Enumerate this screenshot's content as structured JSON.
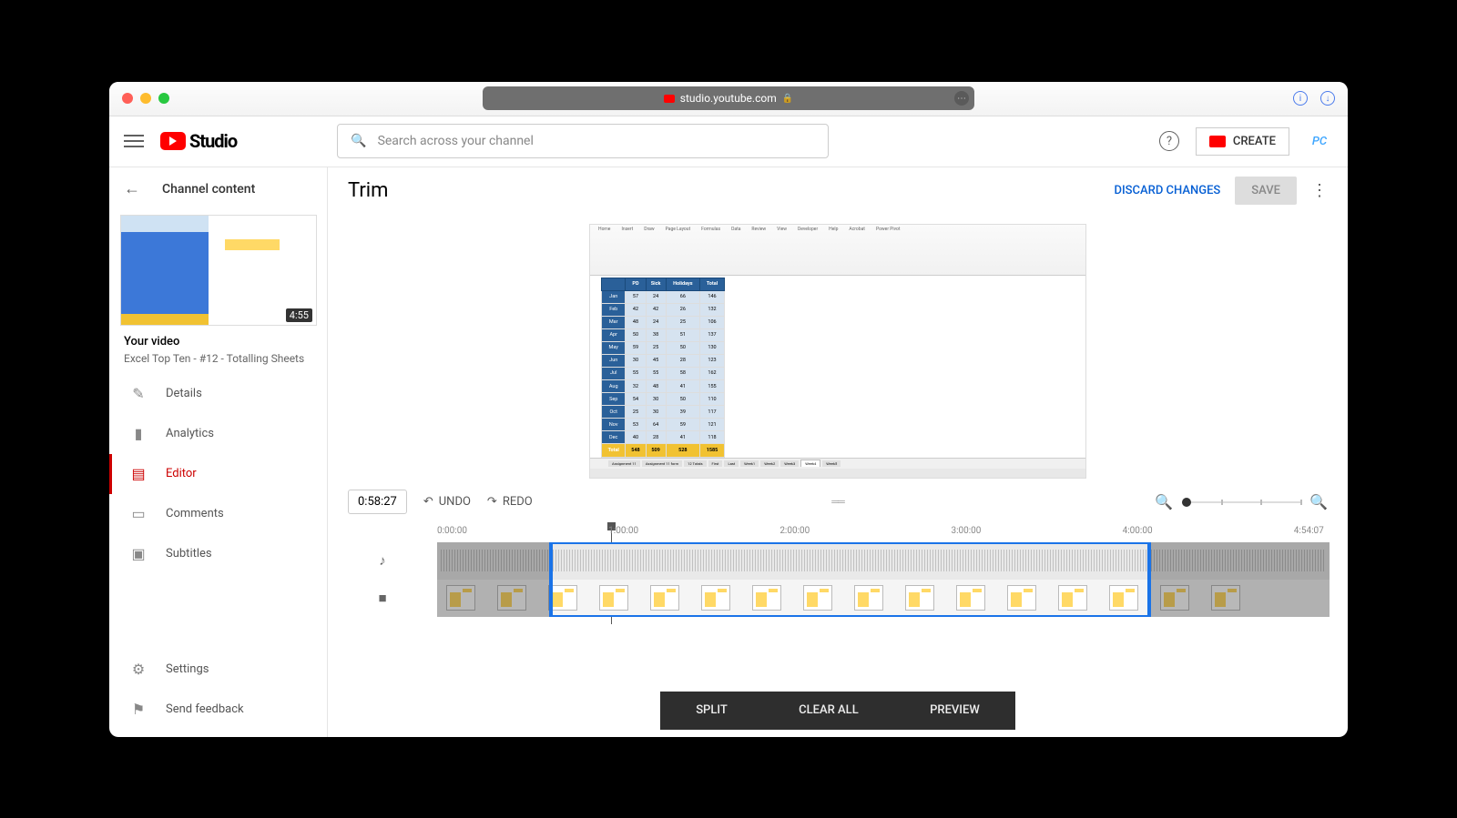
{
  "browser": {
    "url": "studio.youtube.com"
  },
  "header": {
    "logo_text": "Studio",
    "search_placeholder": "Search across your channel",
    "create_label": "CREATE",
    "avatar_text": "PC"
  },
  "sidebar": {
    "back_label": "Channel content",
    "thumb_duration": "4:55",
    "your_video_h": "Your video",
    "your_video_t": "Excel Top Ten - #12 - Totalling Sheets",
    "items": [
      {
        "label": "Details",
        "icon": "✎"
      },
      {
        "label": "Analytics",
        "icon": "▮"
      },
      {
        "label": "Editor",
        "icon": "▤"
      },
      {
        "label": "Comments",
        "icon": "▭"
      },
      {
        "label": "Subtitles",
        "icon": "▣"
      }
    ],
    "bottom": [
      {
        "label": "Settings",
        "icon": "⚙"
      },
      {
        "label": "Send feedback",
        "icon": "⚑"
      }
    ]
  },
  "main": {
    "title": "Trim",
    "discard": "DISCARD CHANGES",
    "save": "SAVE",
    "timecode": "0:58:27",
    "undo": "UNDO",
    "redo": "REDO",
    "ruler": [
      "0:00:00",
      "1:00:00",
      "2:00:00",
      "3:00:00",
      "4:00:00",
      "4:54:07"
    ],
    "bottom": {
      "split": "SPLIT",
      "clear": "CLEAR ALL",
      "preview": "PREVIEW"
    }
  },
  "preview_sheet": {
    "header": [
      "",
      "PD",
      "Sick",
      "Holidays",
      "Total"
    ],
    "rows": [
      [
        "Jan",
        "57",
        "24",
        "66",
        "146"
      ],
      [
        "Feb",
        "42",
        "42",
        "26",
        "132"
      ],
      [
        "Mar",
        "48",
        "24",
        "25",
        "106"
      ],
      [
        "Apr",
        "50",
        "38",
        "51",
        "137"
      ],
      [
        "May",
        "59",
        "25",
        "50",
        "130"
      ],
      [
        "Jun",
        "30",
        "45",
        "28",
        "123"
      ],
      [
        "Jul",
        "55",
        "55",
        "58",
        "162"
      ],
      [
        "Aug",
        "32",
        "48",
        "41",
        "155"
      ],
      [
        "Sep",
        "54",
        "30",
        "50",
        "110"
      ],
      [
        "Oct",
        "25",
        "30",
        "39",
        "117"
      ],
      [
        "Nov",
        "53",
        "64",
        "59",
        "121"
      ],
      [
        "Dec",
        "40",
        "28",
        "41",
        "118"
      ],
      [
        "Total",
        "548",
        "509",
        "528",
        "1585"
      ]
    ],
    "tabs": [
      "Assignment 11",
      "Assignment 11 form",
      "12 Totals",
      "First",
      "Last",
      "Week1",
      "Week2",
      "Week3",
      "Week4",
      "Week5"
    ]
  }
}
